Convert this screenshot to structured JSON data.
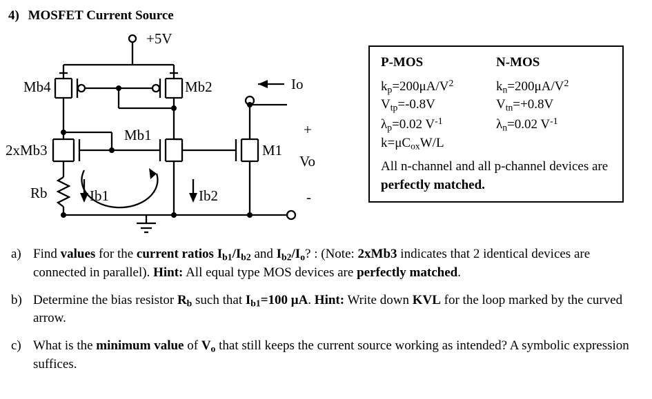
{
  "problem": {
    "number": "4)",
    "title": "MOSFET Current Source"
  },
  "circuit": {
    "vdd": "+5V",
    "mb4": "Mb4",
    "mb2": "Mb2",
    "mb1": "Mb1",
    "mb3": "2xMb3",
    "m1": "M1",
    "rb": "Rb",
    "ib1": "Ib1",
    "ib2": "Ib2",
    "io": "Io",
    "plus": "+",
    "vo": "Vo",
    "minus": "-"
  },
  "params": {
    "pmos_head": "P-MOS",
    "nmos_head": "N-MOS",
    "kp": "k<sub>p</sub>=200μA/V<sup>2</sup>",
    "kn": "k<sub>n</sub>=200μA/V<sup>2</sup>",
    "vtp": "V<sub>tp</sub>=-0.8V",
    "vtn": "V<sub>tn</sub>=+0.8V",
    "lp": "λ<sub>p</sub>=0.02 V<sup>-1</sup>",
    "ln": "λ<sub>n</sub>=0.02 V<sup>-1</sup>",
    "kdef": "k=μC<sub>ox</sub>W/L",
    "note_pre": "All n-channel and all p-channel devices are ",
    "note_b": "perfectly matched."
  },
  "questions": {
    "a_letter": "a)",
    "a_1": "Find ",
    "a_2": "values",
    "a_3": " for the ",
    "a_4": "current ratios I<sub>b1</sub>/I<sub>b2</sub>",
    "a_5": " and ",
    "a_6": "I<sub>b2</sub>/I<sub>o</sub>",
    "a_7": "? : (Note: ",
    "a_8": "2xMb3",
    "a_9": " indicates that 2 identical devices are connected in parallel). ",
    "a_10": "Hint:",
    "a_11": " All equal type MOS devices are ",
    "a_12": "perfectly matched",
    "a_13": ".",
    "b_letter": "b)",
    "b_1": "Determine the bias resistor ",
    "b_2": "R<sub>b</sub>",
    "b_3": " such that ",
    "b_4": "I<sub>b1</sub>=100 μA",
    "b_5": ".  ",
    "b_6": "Hint:",
    "b_7": " Write down ",
    "b_8": "KVL",
    "b_9": " for the loop marked by the curved arrow.",
    "c_letter": "c)",
    "c_1": "What is the ",
    "c_2": "minimum value",
    "c_3": " of ",
    "c_4": "V<sub>o</sub>",
    "c_5": " that still keeps the current source working as intended? A symbolic expression suffices."
  }
}
